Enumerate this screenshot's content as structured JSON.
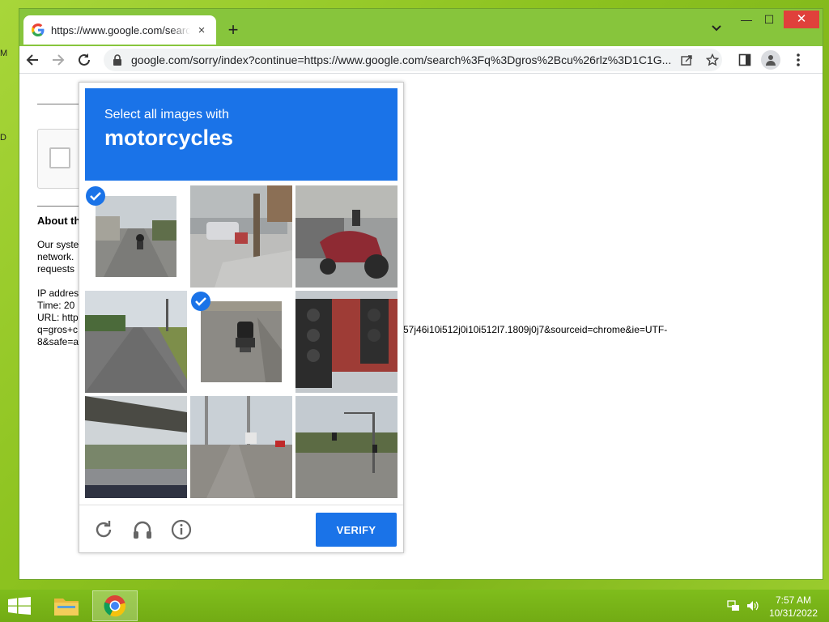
{
  "desktop": {
    "frag_top": "M",
    "frag_mid": "D"
  },
  "browser": {
    "tab_title": "https://www.google.com/search?q=gros",
    "tab_close": "×",
    "new_tab": "+",
    "win_min": "—",
    "win_max": "☐",
    "win_close": "✕",
    "url": "google.com/sorry/index?continue=https://www.google.com/search%3Fq%3Dgros%2Bcu%26rlz%3D1C1G..."
  },
  "page": {
    "about_heading": "About th",
    "lines": [
      "Our syste",
      "network.",
      "requests"
    ],
    "ip_line": "IP addres",
    "time_line": "Time: 20",
    "url_line": "URL: http",
    "q_line": "q=gros+c",
    "safe_line": "8&safe=a",
    "url_tail": "57j46i10i512j0i10i512l7.1809j0j7&sourceid=chrome&ie=UTF-",
    "url_tail2": "8"
  },
  "captcha": {
    "instruction": "Select all images with",
    "target": "motorcycles",
    "verify_label": "VERIFY",
    "tiles": [
      {
        "selected": true
      },
      {
        "selected": false
      },
      {
        "selected": false
      },
      {
        "selected": false
      },
      {
        "selected": true
      },
      {
        "selected": false
      },
      {
        "selected": false
      },
      {
        "selected": false
      },
      {
        "selected": false
      }
    ]
  },
  "taskbar": {
    "time": "7:57 AM",
    "date": "10/31/2022"
  },
  "colors": {
    "captcha_blue": "#1a73e8",
    "desktop_green": "#8cc21f"
  }
}
